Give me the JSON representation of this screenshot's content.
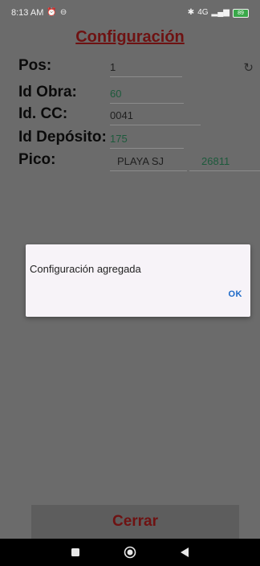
{
  "status_bar": {
    "time": "8:13 AM",
    "alarm_icon": "alarm-clock-icon",
    "app_icon": "circle-app-icon",
    "bluetooth_icon": "bluetooth-icon",
    "network": "4G",
    "battery": "89"
  },
  "screen": {
    "title": "Configuración"
  },
  "fields": {
    "pos": {
      "label": "Pos:",
      "value": "1"
    },
    "obra": {
      "label": "Id Obra:",
      "value": "60"
    },
    "cc": {
      "label": "Id. CC:",
      "value": "0041"
    },
    "deposito": {
      "label": "Id Depósito:",
      "value": "175"
    },
    "pico": {
      "label": "Pico:",
      "value": "PLAYA SJ",
      "value2": "26811"
    }
  },
  "dialog": {
    "message": "Configuración agregada",
    "ok_label": "OK"
  },
  "footer": {
    "close_label": "Cerrar"
  },
  "navbar": {
    "recent_icon": "square-icon",
    "home_icon": "circle-home-icon",
    "back_icon": "triangle-back-icon"
  },
  "colors": {
    "title": "#6e1212",
    "overlay_bg": "#6b6b6b",
    "dialog_bg": "#f7f3f8",
    "ok_text": "#1e6ac8",
    "green_value": "#1d5a3c"
  }
}
